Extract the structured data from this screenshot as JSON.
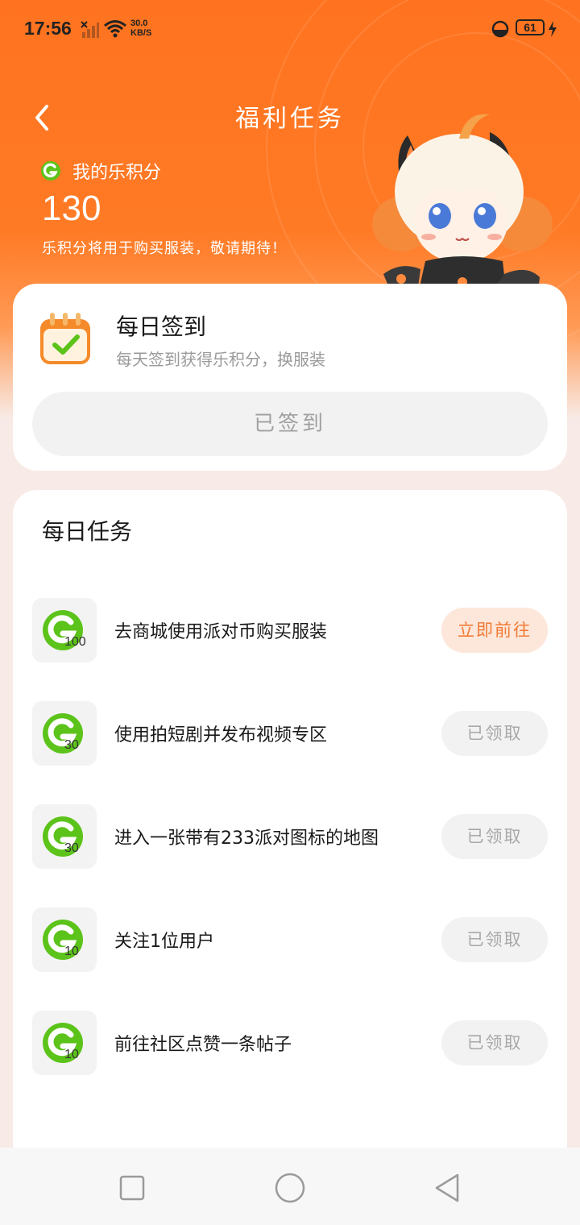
{
  "status_bar": {
    "time": "17:56",
    "speed_value": "30.0",
    "speed_unit": "KB/S",
    "battery": "61"
  },
  "header": {
    "title": "福利任务",
    "back_icon": "chevron-left-icon"
  },
  "points": {
    "label": "我的乐积分",
    "value": "130",
    "hint": "乐积分将用于购买服装，敬请期待！"
  },
  "checkin": {
    "title": "每日签到",
    "subtitle": "每天签到获得乐积分，换服装",
    "button": "已签到"
  },
  "daily_tasks": {
    "title": "每日任务",
    "items": [
      {
        "reward": "100",
        "text": "去商城使用派对币购买服装",
        "button": "立即前往",
        "state": "go"
      },
      {
        "reward": "30",
        "text": "使用拍短剧并发布视频专区",
        "button": "已领取",
        "state": "done"
      },
      {
        "reward": "30",
        "text": "进入一张带有233派对图标的地图",
        "button": "已领取",
        "state": "done"
      },
      {
        "reward": "10",
        "text": "关注1位用户",
        "button": "已领取",
        "state": "done"
      },
      {
        "reward": "10",
        "text": "前往社区点赞一条帖子",
        "button": "已领取",
        "state": "done"
      }
    ]
  },
  "colors": {
    "brand_orange": "#ff7320",
    "coin_green": "#5cc31a",
    "go_button_text": "#f17a34",
    "go_button_bg": "#fde7da"
  },
  "nav_bar": {
    "icons": [
      "recent-apps-icon",
      "home-icon",
      "back-icon"
    ]
  }
}
